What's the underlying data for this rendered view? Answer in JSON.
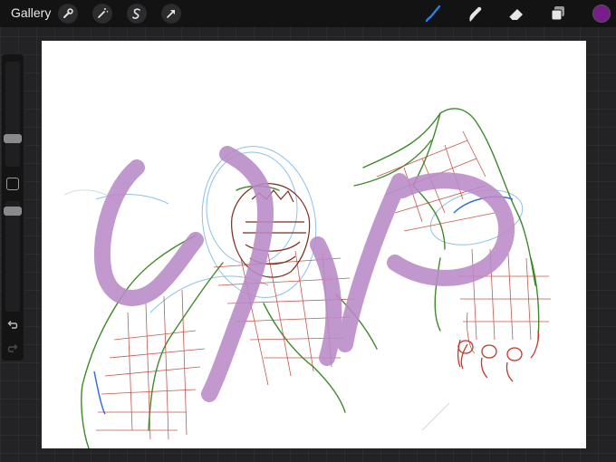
{
  "topbar": {
    "gallery_label": "Gallery",
    "left_tools": [
      "wrench-icon",
      "magic-wand-icon",
      "selection-icon",
      "transform-arrow-icon"
    ],
    "right_tools": [
      "brush-icon",
      "smudge-icon",
      "eraser-icon",
      "layers-icon"
    ],
    "active_tool": "brush-icon",
    "current_color": "#7a1d8c"
  },
  "sidebar": {
    "brush_size_level": 0.25,
    "opacity_level": 0.95
  },
  "colors": {
    "accent": "#2f7de0",
    "stroke_purple": "#b98ac7",
    "sketch_red": "#c0392b",
    "sketch_green": "#3e8a2a",
    "sketch_blue": "#5b9bd5"
  }
}
